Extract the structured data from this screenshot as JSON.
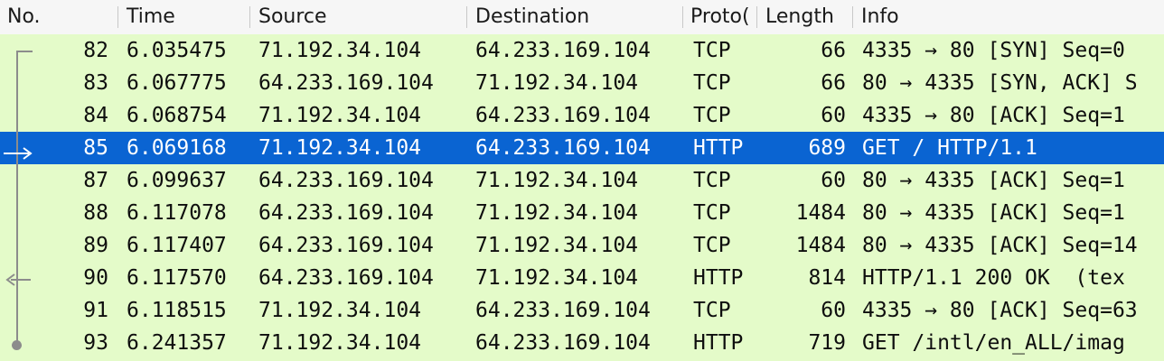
{
  "columns": {
    "no": "No.",
    "time": "Time",
    "source": "Source",
    "destination": "Destination",
    "protocol": "Proto(",
    "length": "Length",
    "info": "Info"
  },
  "packets": [
    {
      "no": "82",
      "time": "6.035475",
      "source": "71.192.34.104",
      "destination": "64.233.169.104",
      "protocol": "TCP",
      "length": "66",
      "info": "4335 → 80 [SYN] Seq=0"
    },
    {
      "no": "83",
      "time": "6.067775",
      "source": "64.233.169.104",
      "destination": "71.192.34.104",
      "protocol": "TCP",
      "length": "66",
      "info": "80 → 4335 [SYN, ACK] S"
    },
    {
      "no": "84",
      "time": "6.068754",
      "source": "71.192.34.104",
      "destination": "64.233.169.104",
      "protocol": "TCP",
      "length": "60",
      "info": "4335 → 80 [ACK] Seq=1"
    },
    {
      "no": "85",
      "time": "6.069168",
      "source": "71.192.34.104",
      "destination": "64.233.169.104",
      "protocol": "HTTP",
      "length": "689",
      "info": "GET / HTTP/1.1"
    },
    {
      "no": "87",
      "time": "6.099637",
      "source": "64.233.169.104",
      "destination": "71.192.34.104",
      "protocol": "TCP",
      "length": "60",
      "info": "80 → 4335 [ACK] Seq=1"
    },
    {
      "no": "88",
      "time": "6.117078",
      "source": "64.233.169.104",
      "destination": "71.192.34.104",
      "protocol": "TCP",
      "length": "1484",
      "info": "80 → 4335 [ACK] Seq=1"
    },
    {
      "no": "89",
      "time": "6.117407",
      "source": "64.233.169.104",
      "destination": "71.192.34.104",
      "protocol": "TCP",
      "length": "1484",
      "info": "80 → 4335 [ACK] Seq=14"
    },
    {
      "no": "90",
      "time": "6.117570",
      "source": "64.233.169.104",
      "destination": "71.192.34.104",
      "protocol": "HTTP",
      "length": "814",
      "info": "HTTP/1.1 200 OK  (tex"
    },
    {
      "no": "91",
      "time": "6.118515",
      "source": "71.192.34.104",
      "destination": "64.233.169.104",
      "protocol": "TCP",
      "length": "60",
      "info": "4335 → 80 [ACK] Seq=63"
    },
    {
      "no": "93",
      "time": "6.241357",
      "source": "71.192.34.104",
      "destination": "64.233.169.104",
      "protocol": "HTTP",
      "length": "719",
      "info": "GET /intl/en_ALL/imag"
    }
  ],
  "selected_no": "85",
  "colors": {
    "row_bg": "#e4fbc9",
    "selected_bg": "#0a64d2",
    "header_bg": "#f6f6f6"
  }
}
